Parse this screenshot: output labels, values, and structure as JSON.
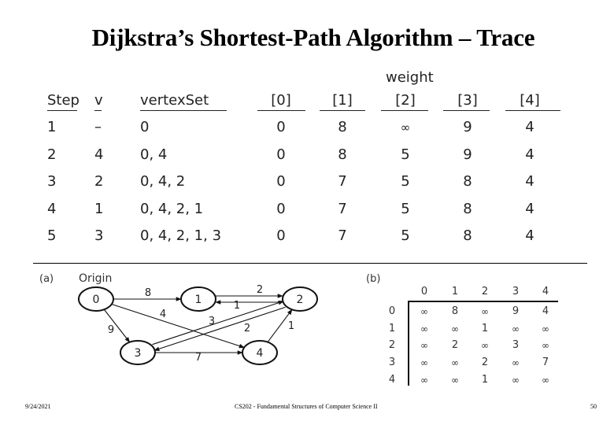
{
  "title": "Dijkstra’s  Shortest-Path Algorithm – Trace",
  "trace_table": {
    "group_header": "weight",
    "headers": [
      "Step",
      "v",
      "vertexSet",
      "[0]",
      "[1]",
      "[2]",
      "[3]",
      "[4]"
    ],
    "rows": [
      [
        "1",
        "–",
        "0",
        "0",
        "8",
        "∞",
        "9",
        "4"
      ],
      [
        "2",
        "4",
        "0, 4",
        "0",
        "8",
        "5",
        "9",
        "4"
      ],
      [
        "3",
        "2",
        "0, 4, 2",
        "0",
        "7",
        "5",
        "8",
        "4"
      ],
      [
        "4",
        "1",
        "0, 4, 2, 1",
        "0",
        "7",
        "5",
        "8",
        "4"
      ],
      [
        "5",
        "3",
        "0, 4, 2, 1, 3",
        "0",
        "7",
        "5",
        "8",
        "4"
      ]
    ]
  },
  "graph": {
    "panel_label": "(a)",
    "origin_label": "Origin",
    "nodes": [
      "0",
      "1",
      "2",
      "3",
      "4"
    ],
    "edges": [
      {
        "from": "0",
        "to": "1",
        "weight": "8"
      },
      {
        "from": "0",
        "to": "3",
        "weight": "9"
      },
      {
        "from": "0",
        "to": "4",
        "weight": "4"
      },
      {
        "from": "1",
        "to": "2",
        "weight": "1"
      },
      {
        "from": "2",
        "to": "1",
        "weight": "2"
      },
      {
        "from": "2",
        "to": "3",
        "weight": "3"
      },
      {
        "from": "3",
        "to": "2",
        "weight": "2"
      },
      {
        "from": "3",
        "to": "4",
        "weight": "7"
      },
      {
        "from": "4",
        "to": "2",
        "weight": "1"
      }
    ]
  },
  "matrix": {
    "panel_label": "(b)",
    "col_headers": [
      "0",
      "1",
      "2",
      "3",
      "4"
    ],
    "row_headers": [
      "0",
      "1",
      "2",
      "3",
      "4"
    ],
    "rows": [
      [
        "∞",
        "8",
        "∞",
        "9",
        "4"
      ],
      [
        "∞",
        "∞",
        "1",
        "∞",
        "∞"
      ],
      [
        "∞",
        "2",
        "∞",
        "3",
        "∞"
      ],
      [
        "∞",
        "∞",
        "2",
        "∞",
        "7"
      ],
      [
        "∞",
        "∞",
        "1",
        "∞",
        "∞"
      ]
    ]
  },
  "footer": {
    "date": "9/24/2021",
    "course": "CS202 - Fundamental Structures of Computer Science II",
    "page": "50"
  }
}
